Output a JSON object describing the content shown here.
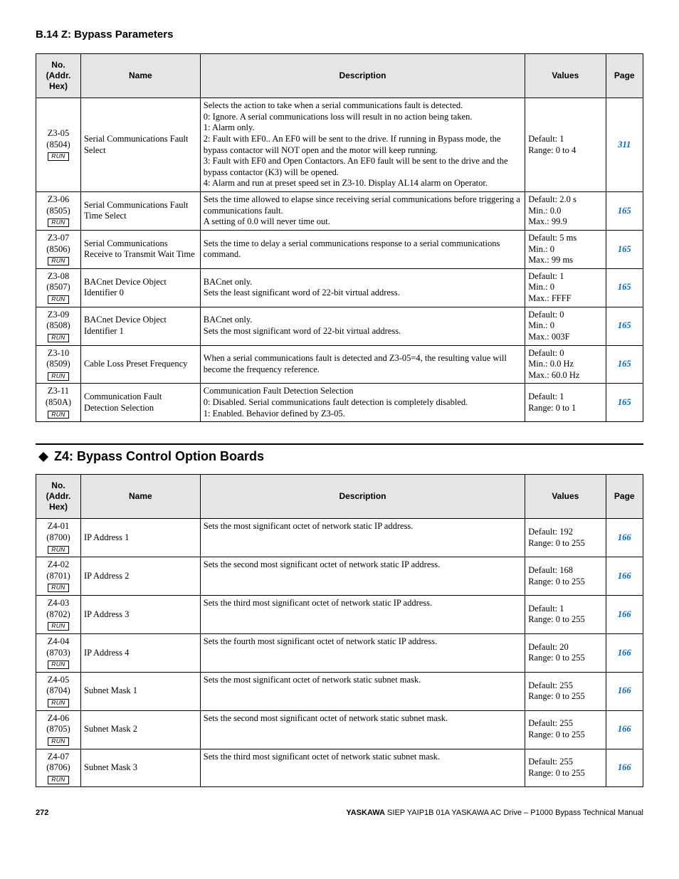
{
  "section_title": "B.14 Z: Bypass Parameters",
  "headers": {
    "no": "No.\n(Addr.\nHex)",
    "name": "Name",
    "desc": "Description",
    "values": "Values",
    "page": "Page"
  },
  "run_label": "RUN",
  "table1": [
    {
      "no": "Z3-05",
      "addr": "(8504)",
      "name": "Serial Communications Fault Select",
      "desc": "Selects the action to take when a serial communications fault is detected.\n0: Ignore. A serial communications loss will result in no action being taken.\n1: Alarm only.\n2: Fault with EF0.. An EF0 will be sent to the drive. If running in Bypass mode, the bypass contactor will NOT open and the motor will keep running.\n3: Fault with EF0 and Open Contactors. An EF0 fault will be sent to the drive and the bypass contactor (K3) will be opened.\n4: Alarm and run at preset speed set in Z3-10. Display AL14 alarm on Operator.",
      "values": "Default: 1\nRange: 0 to 4",
      "page": "311"
    },
    {
      "no": "Z3-06",
      "addr": "(8505)",
      "name": "Serial Communications Fault Time Select",
      "desc": "Sets the time allowed to elapse since receiving serial communications before triggering a communications fault.\nA setting of 0.0 will never time out.",
      "values": "Default: 2.0 s\nMin.: 0.0\nMax.: 99.9",
      "page": "165"
    },
    {
      "no": "Z3-07",
      "addr": "(8506)",
      "name": "Serial Communications Receive to Transmit Wait Time",
      "desc": "Sets the time to delay a serial communications response to a serial communications command.",
      "values": "Default: 5 ms\nMin.: 0\nMax.: 99 ms",
      "page": "165"
    },
    {
      "no": "Z3-08",
      "addr": "(8507)",
      "name": "BACnet Device Object Identifier 0",
      "desc": "BACnet only.\nSets the least significant word of 22-bit virtual address.",
      "values": "Default: 1\nMin.: 0\nMax.: FFFF",
      "page": "165"
    },
    {
      "no": "Z3-09",
      "addr": "(8508)",
      "name": "BACnet Device Object Identifier 1",
      "desc": "BACnet only.\nSets the most significant word of 22-bit virtual address.",
      "values": "Default: 0\nMin.: 0\nMax.: 003F",
      "page": "165"
    },
    {
      "no": "Z3-10",
      "addr": "(8509)",
      "name": "Cable Loss Preset Frequency",
      "desc": "When a serial communications fault is detected and Z3-05=4, the resulting value will become the frequency reference.",
      "values": "Default: 0\nMin.: 0.0 Hz\nMax.: 60.0 Hz",
      "page": "165"
    },
    {
      "no": "Z3-11",
      "addr": "(850A)",
      "name": "Communication Fault Detection Selection",
      "desc": "Communication Fault Detection Selection\n0: Disabled. Serial communications fault detection is completely disabled.\n1: Enabled. Behavior defined by Z3-05.",
      "values": "Default: 1\nRange: 0 to 1",
      "page": "165"
    }
  ],
  "subsection_title": "Z4: Bypass Control Option Boards",
  "table2": [
    {
      "no": "Z4-01",
      "addr": "(8700)",
      "name": "IP Address 1",
      "desc": "Sets the most significant octet of network static IP address.",
      "values": "Default: 192\nRange: 0 to 255",
      "page": "166"
    },
    {
      "no": "Z4-02",
      "addr": "(8701)",
      "name": "IP Address 2",
      "desc": "Sets the second most significant octet of network static IP address.",
      "values": "Default: 168\nRange: 0 to 255",
      "page": "166"
    },
    {
      "no": "Z4-03",
      "addr": "(8702)",
      "name": "IP Address 3",
      "desc": "Sets the third most significant octet of network static IP address.",
      "values": "Default: 1\nRange: 0 to 255",
      "page": "166"
    },
    {
      "no": "Z4-04",
      "addr": "(8703)",
      "name": "IP Address 4",
      "desc": "Sets the fourth most significant octet of network static IP address.",
      "values": "Default: 20\nRange: 0 to 255",
      "page": "166"
    },
    {
      "no": "Z4-05",
      "addr": "(8704)",
      "name": "Subnet Mask 1",
      "desc": "Sets the most significant octet of network static subnet mask.",
      "values": "Default: 255\nRange: 0 to 255",
      "page": "166"
    },
    {
      "no": "Z4-06",
      "addr": "(8705)",
      "name": "Subnet Mask 2",
      "desc": "Sets the second most significant octet of network static subnet mask.",
      "values": "Default: 255\nRange: 0 to 255",
      "page": "166"
    },
    {
      "no": "Z4-07",
      "addr": "(8706)",
      "name": "Subnet Mask 3",
      "desc": "Sets the third most significant octet of network static subnet mask.",
      "values": "Default: 255\nRange: 0 to 255",
      "page": "166"
    }
  ],
  "footer": {
    "page_number": "272",
    "brand": "YASKAWA",
    "manual": " SIEP YAIP1B 01A YASKAWA AC Drive – P1000 Bypass Technical Manual"
  }
}
